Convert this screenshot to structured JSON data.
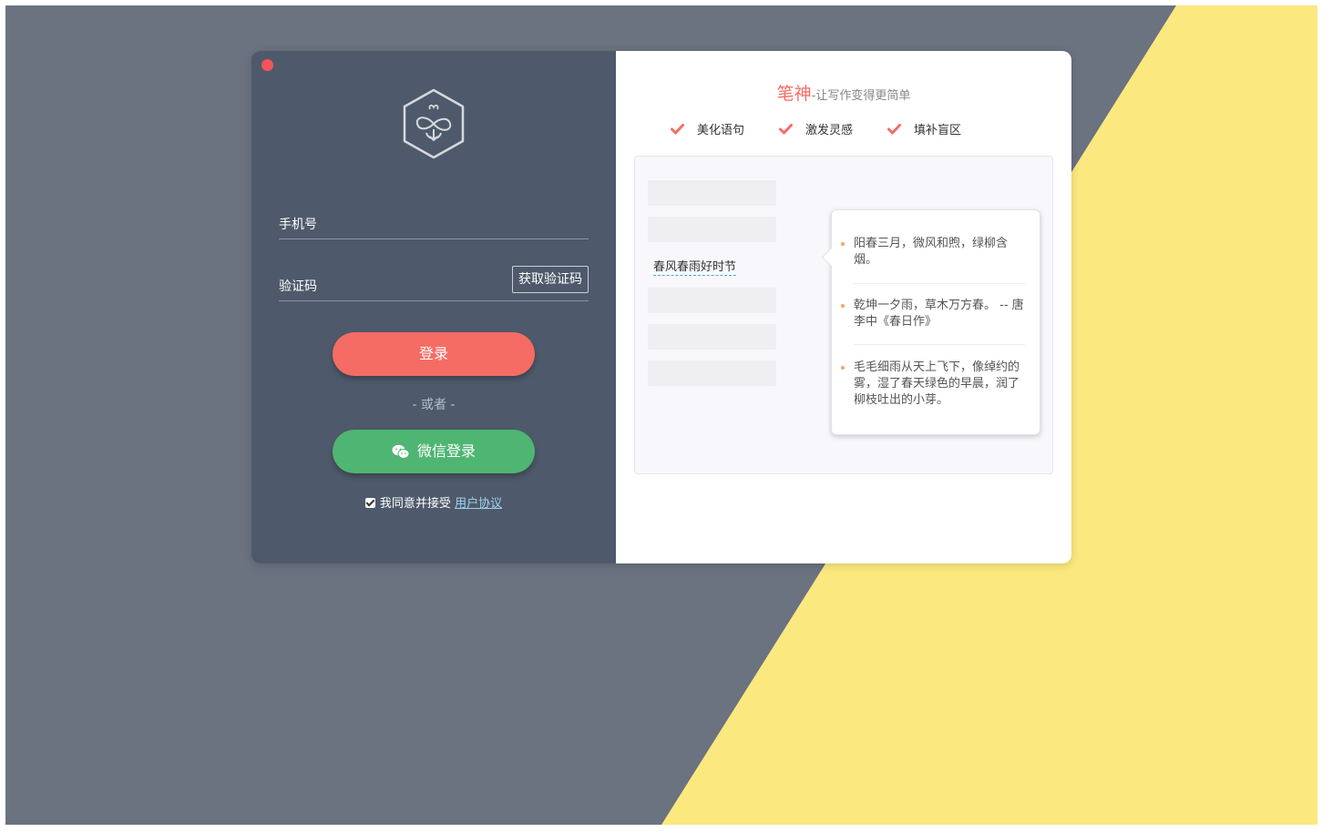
{
  "colors": {
    "background_gray": "#6b7280",
    "background_yellow": "#fbe87e",
    "left_panel": "#4e5a6b",
    "accent_red": "#f56c64",
    "wechat_green": "#4fb572",
    "close_dot": "#f2545b"
  },
  "login": {
    "logo_icon": "bee-hexagon-logo",
    "phone_label": "手机号",
    "code_label": "验证码",
    "get_code_button": "获取验证码",
    "login_button": "登录",
    "or_text": "- 或者 -",
    "wechat_button": "微信登录",
    "agree_text": "我同意并接受",
    "agreement_link": "用户协议",
    "agree_checked": true
  },
  "promo": {
    "brand": "笔神",
    "slogan": "-让写作变得更简单",
    "features": [
      "美化语句",
      "激发灵感",
      "填补盲区"
    ],
    "sample_text": "春风春雨好时节",
    "suggestions": [
      "阳春三月，微风和煦，绿柳含烟。",
      "乾坤一夕雨，草木万方春。 -- 唐 李中《春日作》",
      "毛毛细雨从天上飞下，像绰约的雾，湿了春天绿色的早晨，润了柳枝吐出的小芽。"
    ]
  }
}
